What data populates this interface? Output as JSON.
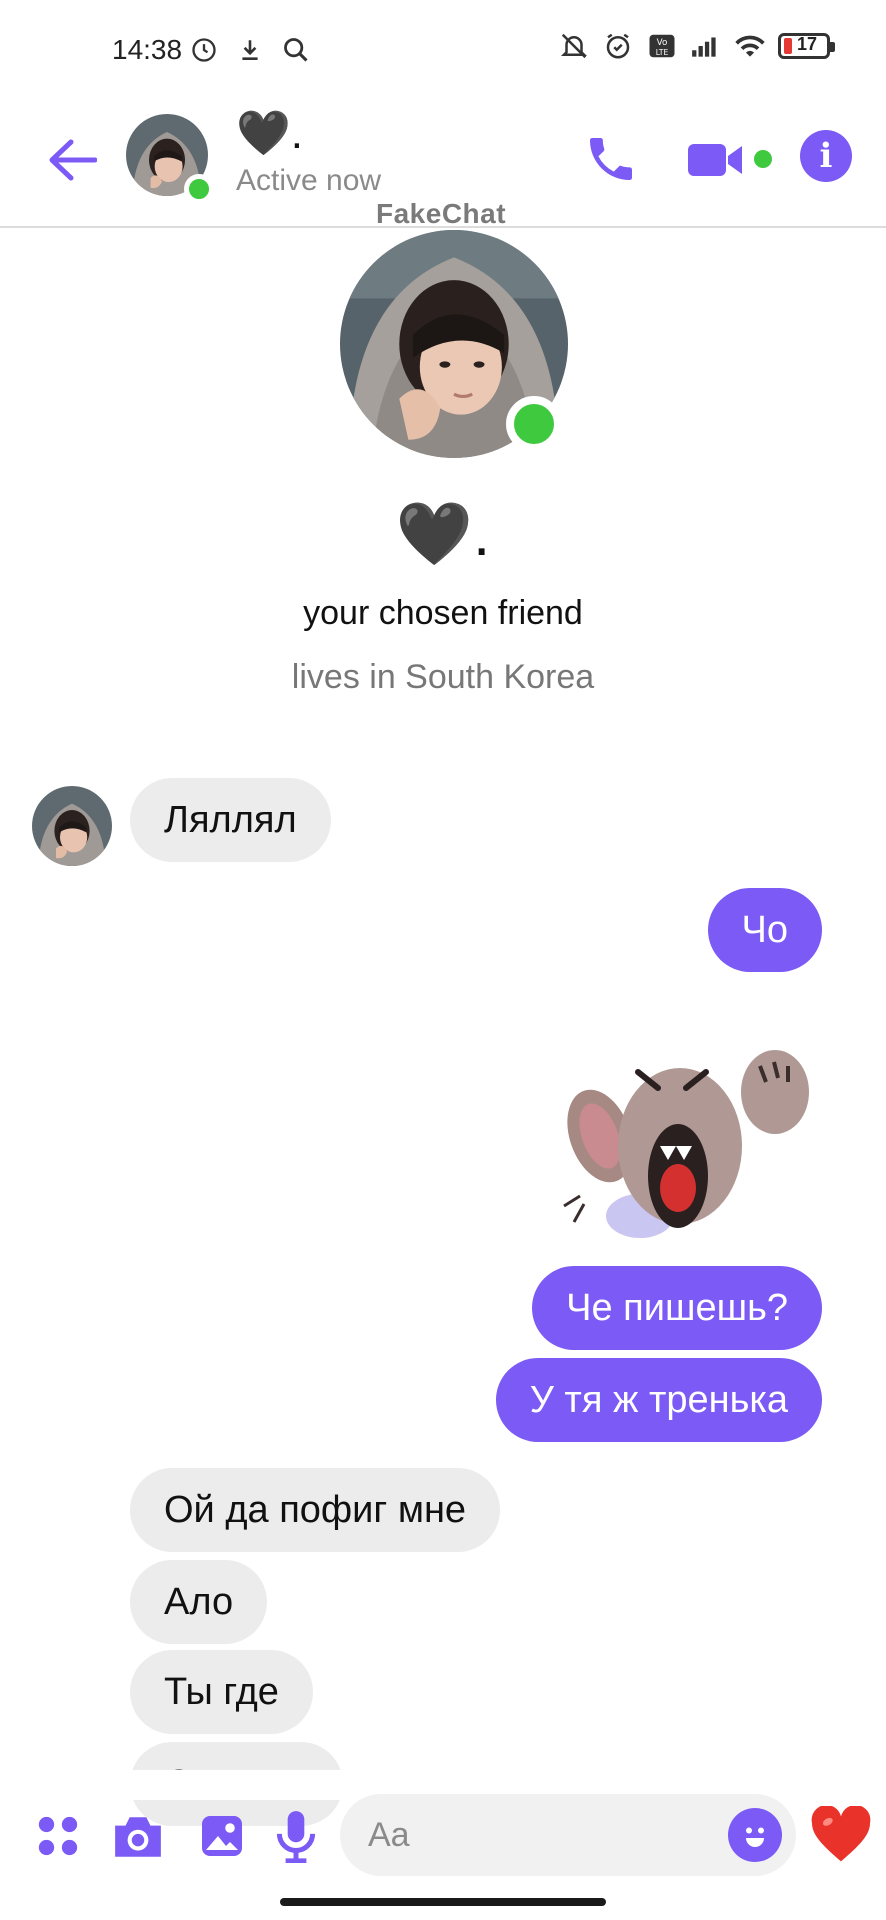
{
  "status_bar": {
    "time": "14:38",
    "left_icons": [
      "alarm-clock-icon",
      "download-icon",
      "search-icon"
    ],
    "right_icons": [
      "bell-off-icon",
      "alarm-icon",
      "volte-icon",
      "signal-icon",
      "wifi-icon"
    ],
    "battery": "17",
    "colors": {
      "battery_low": "#e53935"
    }
  },
  "header": {
    "contact_name": "🖤.",
    "contact_status": "Active now",
    "icons": [
      "back-arrow-icon",
      "phone-icon",
      "video-camera-icon",
      "info-icon"
    ]
  },
  "watermark": "FakeChat",
  "profile": {
    "name": "🖤.",
    "tagline": "your chosen friend",
    "location": "lives in South Korea"
  },
  "messages": [
    {
      "side": "in",
      "text": "Ляллял"
    },
    {
      "side": "out",
      "text": "Чо"
    },
    {
      "side": "out",
      "type": "sticker",
      "sticker": "angry-elephant-sticker"
    },
    {
      "side": "out",
      "text": "Че пишешь?"
    },
    {
      "side": "out",
      "text": "У тя ж тренька"
    },
    {
      "side": "in",
      "text": "Ой да пофиг мне"
    },
    {
      "side": "in",
      "text": "Ало"
    },
    {
      "side": "in",
      "text": "Ты где"
    },
    {
      "side": "in",
      "text": "Отвееть"
    }
  ],
  "composer": {
    "placeholder": "Aa",
    "icons": [
      "apps-grid-icon",
      "camera-icon",
      "gallery-icon",
      "microphone-icon",
      "emoji-icon",
      "heart-icon"
    ]
  },
  "colors": {
    "accent": "#7b5af5",
    "online": "#3ec93e",
    "incoming_bubble": "#ececec",
    "heart": "#e8322a"
  }
}
